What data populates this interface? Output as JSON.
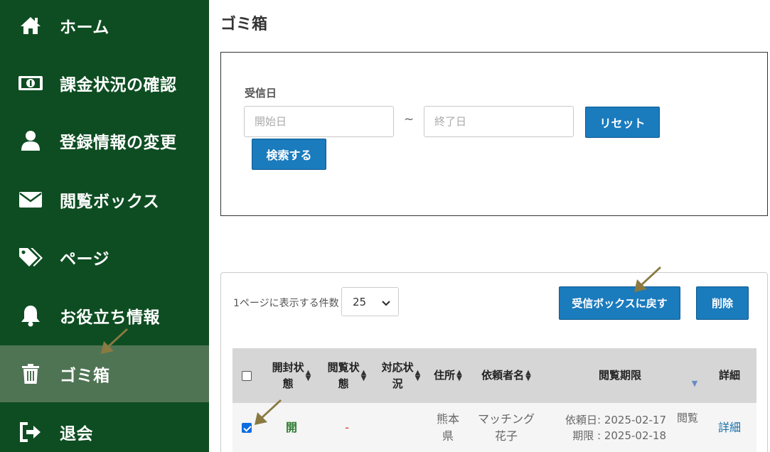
{
  "sidebar": {
    "items": [
      {
        "label": "ホーム",
        "icon": "home-icon"
      },
      {
        "label": "課金状況の確認",
        "icon": "money-icon"
      },
      {
        "label": "登録情報の変更",
        "icon": "user-icon"
      },
      {
        "label": "閲覧ボックス",
        "icon": "envelope-icon"
      },
      {
        "label": "ページ",
        "icon": "tags-icon"
      },
      {
        "label": "お役立ち情報",
        "icon": "bell-icon"
      },
      {
        "label": "ゴミ箱",
        "icon": "trash-icon",
        "active": true
      },
      {
        "label": "退会",
        "icon": "sign-out-icon"
      }
    ]
  },
  "page": {
    "title": "ゴミ箱"
  },
  "search": {
    "label": "受信日",
    "start_placeholder": "開始日",
    "end_placeholder": "終了日",
    "separator": "~",
    "reset_label": "リセット",
    "search_label": "検索する"
  },
  "list": {
    "per_page_label": "1ページに表示する件数",
    "per_page_value": "25",
    "restore_label": "受信ボックスに戻す",
    "delete_label": "削除"
  },
  "table": {
    "headers": {
      "opened": "開封状\n態",
      "viewed": "閲覧状\n態",
      "response": "対応状\n況",
      "address": "住所",
      "requester": "依頼者名",
      "deadline": "閲覧期限",
      "detail": "詳細"
    },
    "rows": [
      {
        "checked": true,
        "opened": "開",
        "viewed": "-",
        "address": "熊本\n県",
        "requester": "マッチング\n花子",
        "deadline_line1": "依頼日: 2025-02-17",
        "deadline_tag": "閲覧",
        "deadline_line2": "期限 : 2025-02-18",
        "detail": "詳細"
      }
    ]
  },
  "colors": {
    "sidebar_bg": "#0e4d22",
    "sidebar_active": "#4f7454",
    "primary_button": "#1a7bbd",
    "opened_text": "#2e7d32",
    "viewed_text": "#d32f2f",
    "annotation_arrow": "#8a7a42"
  }
}
